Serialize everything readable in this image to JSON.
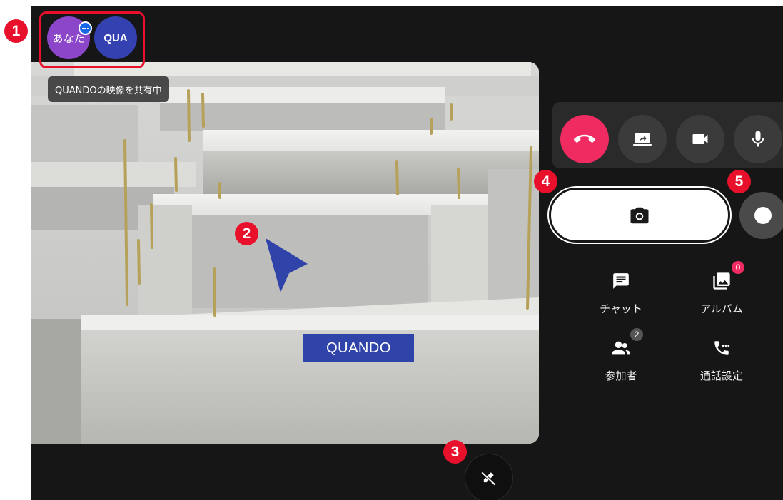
{
  "participants": [
    {
      "label": "あなた",
      "color": "#8b46c9"
    },
    {
      "label": "QUA",
      "color": "#3441b0"
    }
  ],
  "video": {
    "share_tooltip": "QUANDOの映像を共有中",
    "pointer_label": "QUANDO",
    "pointer_color": "#2f43a8"
  },
  "call_controls": [
    {
      "name": "hangup",
      "icon": "phone-hangup-icon",
      "color": "#ef2b62"
    },
    {
      "name": "screen-share",
      "icon": "screen-share-icon"
    },
    {
      "name": "camera",
      "icon": "video-camera-icon"
    },
    {
      "name": "microphone",
      "icon": "microphone-icon"
    }
  ],
  "capture": {
    "snapshot_icon": "camera-icon",
    "record_icon": "record-icon"
  },
  "menu": {
    "chat": {
      "label": "チャット",
      "icon": "chat-icon"
    },
    "album": {
      "label": "アルバム",
      "icon": "photo-album-icon",
      "badge": "0"
    },
    "participants": {
      "label": "参加者",
      "icon": "people-icon",
      "badge": "2"
    },
    "call_settings": {
      "label": "通話設定",
      "icon": "phone-settings-icon"
    }
  },
  "draw_button": {
    "icon": "pen-off-icon"
  },
  "markers": [
    "1",
    "2",
    "3",
    "4",
    "5"
  ],
  "colors": {
    "background": "#161616",
    "accent": "#ef2b62",
    "marker": "#e8102a"
  }
}
